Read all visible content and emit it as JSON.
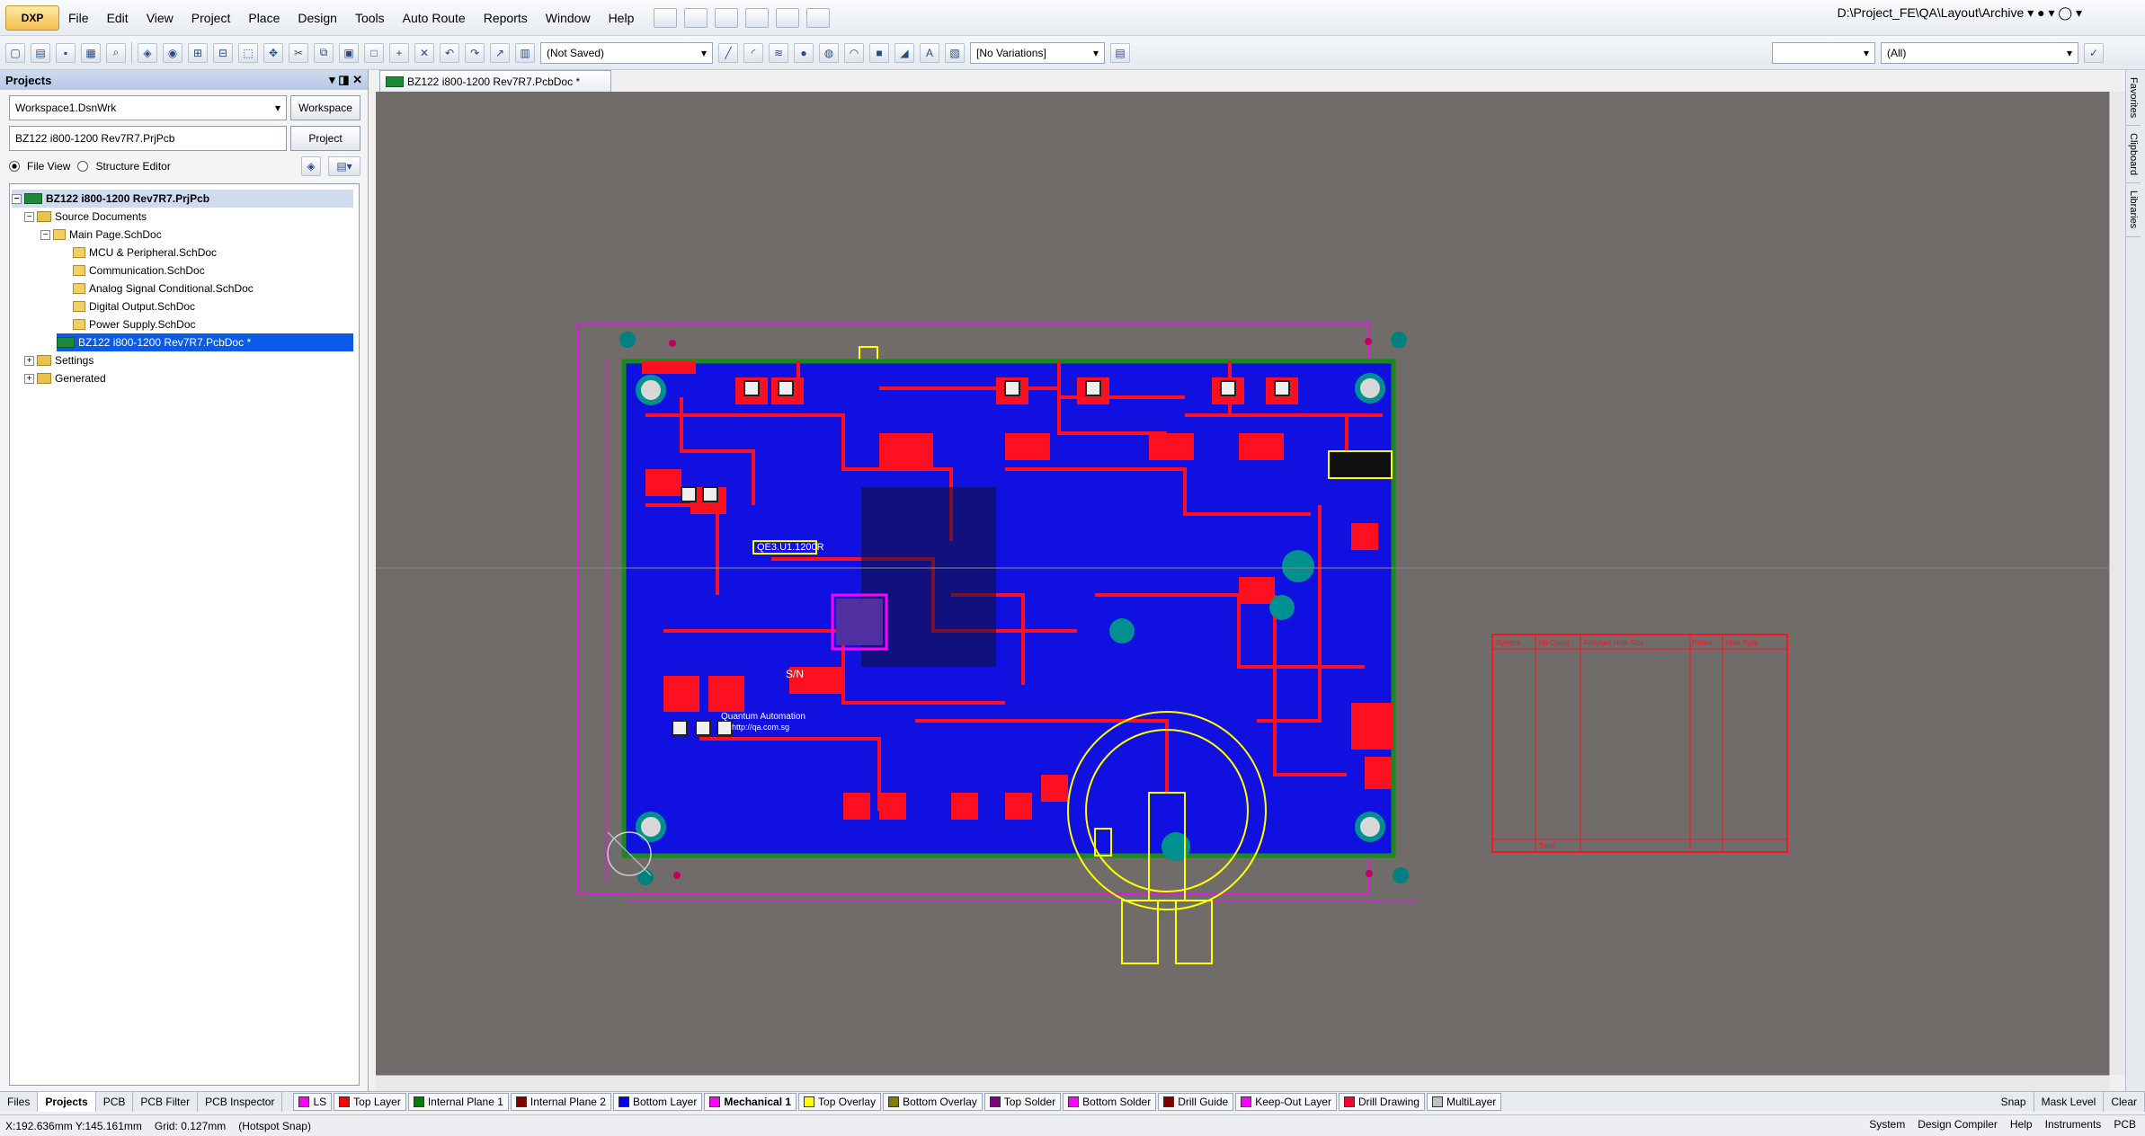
{
  "menubar": {
    "logo": "DXP",
    "items": [
      "File",
      "Edit",
      "View",
      "Project",
      "Place",
      "Design",
      "Tools",
      "Auto Route",
      "Reports",
      "Window",
      "Help"
    ],
    "path": "D:\\Project_FE\\QA\\Layout\\Archive"
  },
  "toolbar": {
    "saved_state": "(Not Saved)",
    "variations": "[No Variations]",
    "filter_all": "(All)"
  },
  "projects_panel": {
    "title": "Projects",
    "workspace_value": "Workspace1.DsnWrk",
    "workspace_button": "Workspace",
    "project_value": "BZ122 i800-1200 Rev7R7.PrjPcb",
    "project_button": "Project",
    "file_view": "File View",
    "structure_editor": "Structure Editor",
    "tree": {
      "root": "BZ122 i800-1200 Rev7R7.PrjPcb",
      "source_documents": "Source Documents",
      "main_page": "Main Page.SchDoc",
      "children": [
        "MCU & Peripheral.SchDoc",
        "Communication.SchDoc",
        "Analog Signal Conditional.SchDoc",
        "Digital Output.SchDoc",
        "Power Supply.SchDoc"
      ],
      "pcb_doc": "BZ122 i800-1200 Rev7R7.PcbDoc *",
      "settings": "Settings",
      "generated": "Generated"
    }
  },
  "document_tab": "BZ122 i800-1200 Rev7R7.PcbDoc *",
  "panel_tabs": [
    "Files",
    "Projects",
    "PCB",
    "PCB Filter",
    "PCB Inspector"
  ],
  "layers": [
    {
      "name": "LS",
      "color": "#ff00ff"
    },
    {
      "name": "Top Layer",
      "color": "#ff0000"
    },
    {
      "name": "Internal Plane 1",
      "color": "#008000"
    },
    {
      "name": "Internal Plane 2",
      "color": "#800000"
    },
    {
      "name": "Bottom Layer",
      "color": "#0000ff"
    },
    {
      "name": "Mechanical 1",
      "color": "#ff00ff"
    },
    {
      "name": "Top Overlay",
      "color": "#ffff00"
    },
    {
      "name": "Bottom Overlay",
      "color": "#808000"
    },
    {
      "name": "Top Solder",
      "color": "#800080"
    },
    {
      "name": "Bottom Solder",
      "color": "#ff00ff"
    },
    {
      "name": "Drill Guide",
      "color": "#800000"
    },
    {
      "name": "Keep-Out Layer",
      "color": "#ff00ff"
    },
    {
      "name": "Drill Drawing",
      "color": "#ff0033"
    },
    {
      "name": "MultiLayer",
      "color": "#c0c0c0"
    }
  ],
  "layer_controls": {
    "snap": "Snap",
    "mask": "Mask Level",
    "clear": "Clear"
  },
  "status": {
    "coords": "X:192.636mm Y:145.161mm",
    "grid": "Grid: 0.127mm",
    "snap": "(Hotspot Snap)",
    "right": [
      "System",
      "Design Compiler",
      "Help",
      "Instruments",
      "PCB"
    ]
  },
  "right_tabs": [
    "Favorites",
    "Clipboard",
    "Libraries"
  ],
  "board": {
    "silk_text_1": "QE3.U1.1200R",
    "silk_text_2": "S/N",
    "silk_text_3": "Quantum Automation",
    "silk_text_4": "http://qa.com.sg"
  },
  "drill_table": {
    "headers": [
      "Symbol",
      "Hit Count",
      "Finished Hole Size",
      "Plated",
      "Hole Type"
    ],
    "total": "Total"
  },
  "colors": {
    "canvas": "#706c69",
    "board": "#1010e0",
    "copper": "#ff1020",
    "overlay": "#ffff00",
    "keepout": "#ff00ff"
  }
}
